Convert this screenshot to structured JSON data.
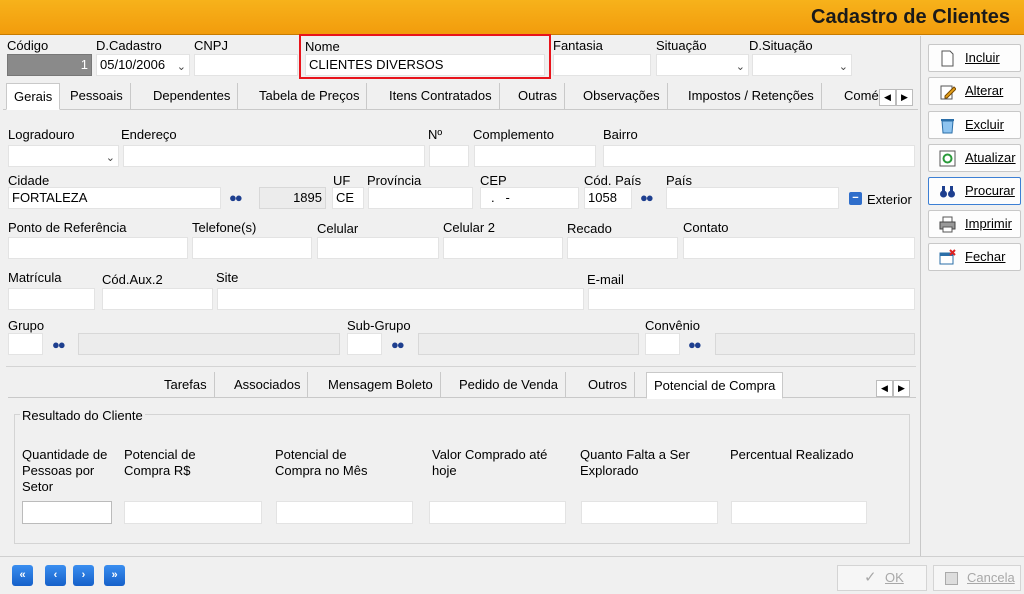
{
  "window": {
    "title": "Cadastro de Clientes"
  },
  "top": {
    "codigo_label": "Código",
    "codigo_value": "1",
    "dcadastro_label": "D.Cadastro",
    "dcadastro_value": "05/10/2006",
    "cnpj_label": "CNPJ",
    "nome_label": "Nome",
    "nome_value": "CLIENTES DIVERSOS",
    "fantasia_label": "Fantasia",
    "situacao_label": "Situação",
    "dsituacao_label": "D.Situação",
    "highlight_color": "#e8141c"
  },
  "tabs": [
    "Gerais",
    "Pessoais",
    "Dependentes",
    "Tabela de Preços",
    "Itens Contratados",
    "Outras",
    "Observações",
    "Impostos / Retenções",
    "Comé"
  ],
  "form": {
    "logradouro": "Logradouro",
    "endereco": "Endereço",
    "numero": "Nº",
    "complemento": "Complemento",
    "bairro": "Bairro",
    "cidade": "Cidade",
    "cidade_value": "FORTALEZA",
    "cidade_code": "1895",
    "uf": "UF",
    "uf_value": "CE",
    "provincia": "Província",
    "cep": "CEP",
    "cep_value": ".   -",
    "cod_pais": "Cód. País",
    "cod_pais_value": "1058",
    "pais": "País",
    "exterior": "Exterior",
    "ponto_ref": "Ponto de Referência",
    "telefones": "Telefone(s)",
    "celular": "Celular",
    "celular2": "Celular 2",
    "recado": "Recado",
    "contato": "Contato",
    "matricula": "Matrícula",
    "cod_aux2": "Cód.Aux.2",
    "site": "Site",
    "email": "E-mail",
    "grupo": "Grupo",
    "subgrupo": "Sub-Grupo",
    "convenio": "Convênio"
  },
  "subtabs": [
    "Tarefas",
    "Associados",
    "Mensagem Boleto",
    "Pedido de Venda",
    "Outros",
    "Potencial de Compra"
  ],
  "resultado": {
    "title": "Resultado do Cliente",
    "cols": [
      "Quantidade de Pessoas por Setor",
      "Potencial de Compra R$",
      "Potencial de Compra no Mês",
      "Valor Comprado até hoje",
      "Quanto Falta a Ser Explorado",
      "Percentual Realizado"
    ]
  },
  "side": {
    "incluir": "Incluir",
    "alterar": "Alterar",
    "excluir": "Excluir",
    "atualizar": "Atualizar",
    "procurar": "Procurar",
    "imprimir": "Imprimir",
    "fechar": "Fechar"
  },
  "footer": {
    "ok": "OK",
    "cancela": "Cancela"
  }
}
